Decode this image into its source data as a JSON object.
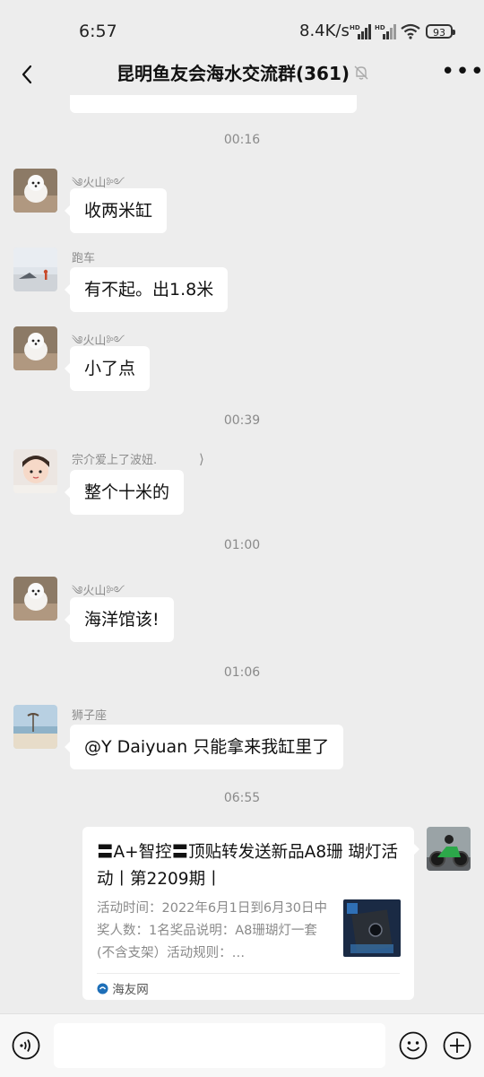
{
  "status_bar": {
    "time": "6:57",
    "network_speed": "8.4K/s",
    "battery": "93",
    "icons": [
      "hd-signal-icon",
      "hd-signal-icon",
      "wifi-icon",
      "battery-icon"
    ]
  },
  "header": {
    "title": "昆明鱼友会海水交流群(361)",
    "icons": [
      "back-icon",
      "mute-bell-icon",
      "more-icon"
    ]
  },
  "messages": {
    "ts1": "00:16",
    "ts2": "00:39",
    "ts3": "01:00",
    "ts4": "01:06",
    "ts5": "06:55",
    "m1": {
      "nick": "༄火山༻",
      "text": "收两米缸"
    },
    "m2": {
      "nick": "跑车",
      "text": "有不起。出1.8米"
    },
    "m3": {
      "nick": "༄火山༻",
      "text": "小了点"
    },
    "m4": {
      "nick": "宗介爱上了波妞.",
      "nick_mark": "⟩",
      "text": "整个十米的"
    },
    "m5": {
      "nick": "༄火山༻",
      "text": "海洋馆该!"
    },
    "m6": {
      "nick": "狮子座",
      "text": "@Y Daiyuan  只能拿来我缸里了"
    }
  },
  "link_card": {
    "title": "〓A+智控〓顶贴转发送新品A8珊 瑚灯活动丨第2209期丨",
    "description": "活动时间：2022年6月1日到6月30日中奖人数：1名奖品说明：A8珊瑚灯一套(不含支架）活动规则：…",
    "source": "海友网",
    "source_icon": "site-logo-icon"
  },
  "bottom_bar": {
    "icons": [
      "voice-icon",
      "emoji-icon",
      "plus-icon"
    ],
    "input_value": ""
  },
  "colors": {
    "background": "#ededed",
    "bubble": "#ffffff",
    "timestamp": "#8a8a8a"
  }
}
